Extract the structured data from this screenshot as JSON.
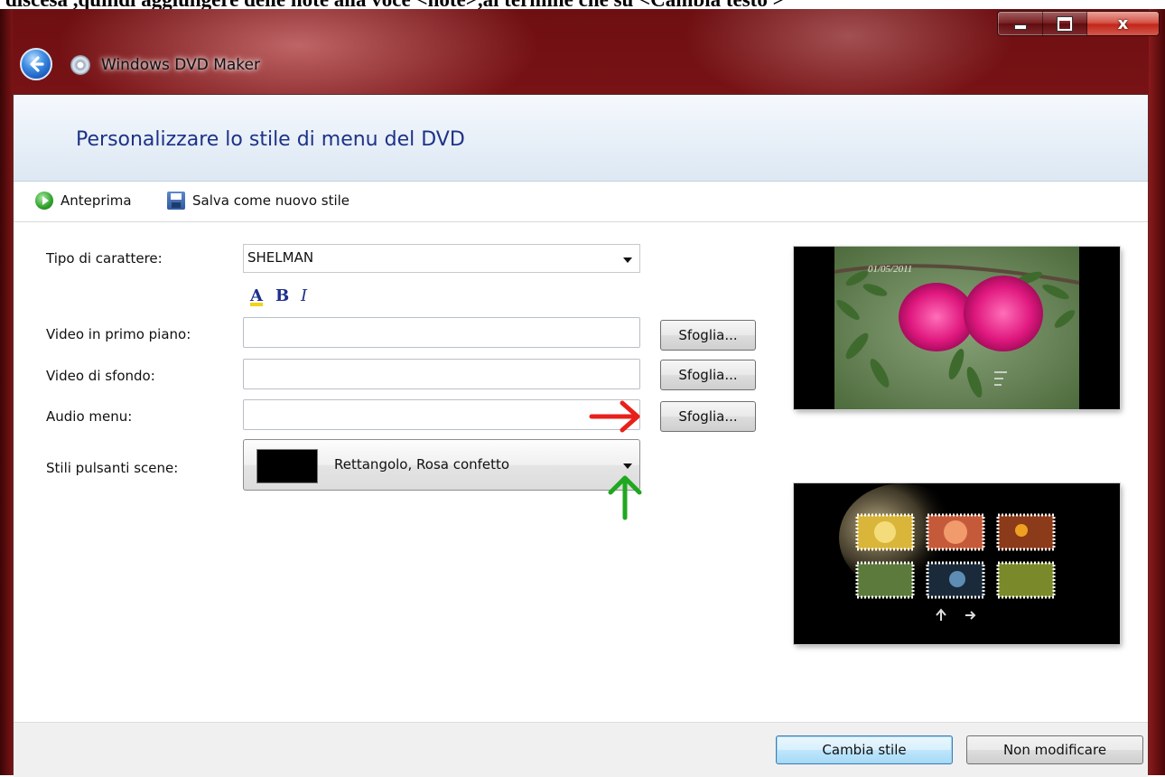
{
  "caption": "discesa ,quindi aggiungere delle note alla voce <note>,al termine che su <Cambia testo >",
  "window": {
    "app_title": "Windows DVD Maker",
    "controls": {
      "minimize": "minimize",
      "maximize": "maximize",
      "close_glyph": "x"
    }
  },
  "page": {
    "title": "Personalizzare lo stile di menu del DVD"
  },
  "toolbar": {
    "preview_label": "Anteprima",
    "save_style_label": "Salva come nuovo stile"
  },
  "form": {
    "font_label": "Tipo di carattere:",
    "font_value": "SHELMAN",
    "format_buttons": {
      "color": "A",
      "bold": "B",
      "italic": "I"
    },
    "foreground_video_label": "Video in primo piano:",
    "foreground_video_value": "",
    "background_video_label": "Video di sfondo:",
    "background_video_value": "",
    "audio_label": "Audio menu:",
    "audio_value": "",
    "browse_label": "Sfoglia...",
    "scene_styles_label": "Stili pulsanti scene:",
    "scene_styles_value": "Rettangolo, Rosa confetto"
  },
  "preview": {
    "main_date_overlay": "01/05/2011",
    "icons": [
      "flower-preview-image",
      "scene-thumbnails-preview"
    ]
  },
  "actions": {
    "change_style_label": "Cambia stile",
    "dont_change_label": "Non modificare"
  },
  "annotations": {
    "red_arrow_color": "#e8201c",
    "green_arrow_color": "#1fa81f"
  }
}
